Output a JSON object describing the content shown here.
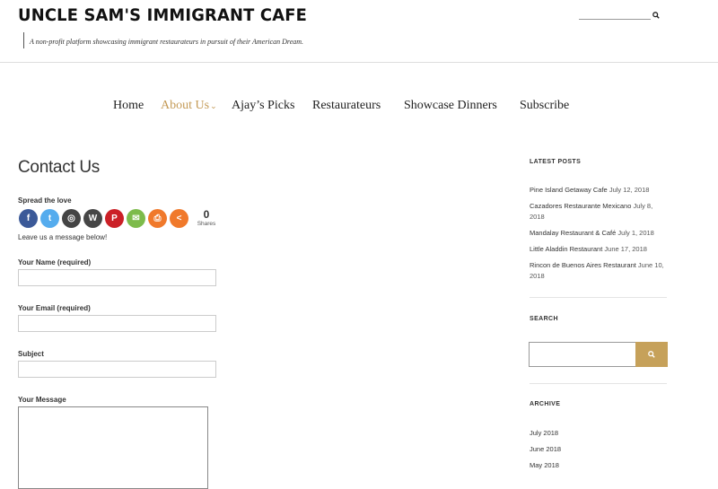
{
  "header": {
    "site_title": "UNCLE SAM'S IMMIGRANT CAFE",
    "tagline": "A non-profit platform showcasing immigrant restaurateurs in pursuit of their American Dream.",
    "search_icon": "search-icon"
  },
  "nav": {
    "items": [
      {
        "label": "Home"
      },
      {
        "label": "About Us",
        "caret": "⌄",
        "active": true
      },
      {
        "label": "Ajay’s Picks"
      },
      {
        "label": "Restaurateurs"
      },
      {
        "label": "Showcase Dinners"
      },
      {
        "label": "Subscribe"
      }
    ],
    "active_color": "#c49a56"
  },
  "main": {
    "title": "Contact Us",
    "spread_label": "Spread the love",
    "share_buttons": [
      {
        "icon": "facebook-icon",
        "glyph": "f",
        "color": "#3b5998"
      },
      {
        "icon": "twitter-icon",
        "glyph": "t",
        "color": "#55acee"
      },
      {
        "icon": "instagram-icon",
        "glyph": "◎",
        "color": "#444444"
      },
      {
        "icon": "wordpress-icon",
        "glyph": "W",
        "color": "#464646"
      },
      {
        "icon": "pinterest-icon",
        "glyph": "P",
        "color": "#cb2027"
      },
      {
        "icon": "email-icon",
        "glyph": "✉",
        "color": "#7dbb4b"
      },
      {
        "icon": "print-icon",
        "glyph": "⎙",
        "color": "#f0792b"
      },
      {
        "icon": "share-more-icon",
        "glyph": "<",
        "color": "#f0792b"
      }
    ],
    "share_count": "0",
    "share_count_label": "Shares",
    "leave_message": "Leave us a message below!",
    "form": {
      "name_label": "Your Name (required)",
      "email_label": "Your Email (required)",
      "subject_label": "Subject",
      "message_label": "Your Message"
    }
  },
  "sidebar": {
    "latest_posts_heading": "LATEST POSTS",
    "posts": [
      {
        "title": "Pine Island Getaway Cafe",
        "date": "July 12, 2018"
      },
      {
        "title": "Cazadores Restaurante Mexicano ",
        "date": "July 8, 2018"
      },
      {
        "title": "Mandalay Restaurant & Café",
        "date": "July 1, 2018"
      },
      {
        "title": "Little Aladdin Restaurant",
        "date": "June 17, 2018"
      },
      {
        "title": "Rincon de Buenos Aires Restaurant",
        "date": "June 10, 2018"
      }
    ],
    "search_heading": "SEARCH",
    "search_button_color": "#c6a15a",
    "archive_heading": "ARCHIVE",
    "archive": [
      "July 2018",
      "June 2018",
      "May 2018"
    ]
  }
}
